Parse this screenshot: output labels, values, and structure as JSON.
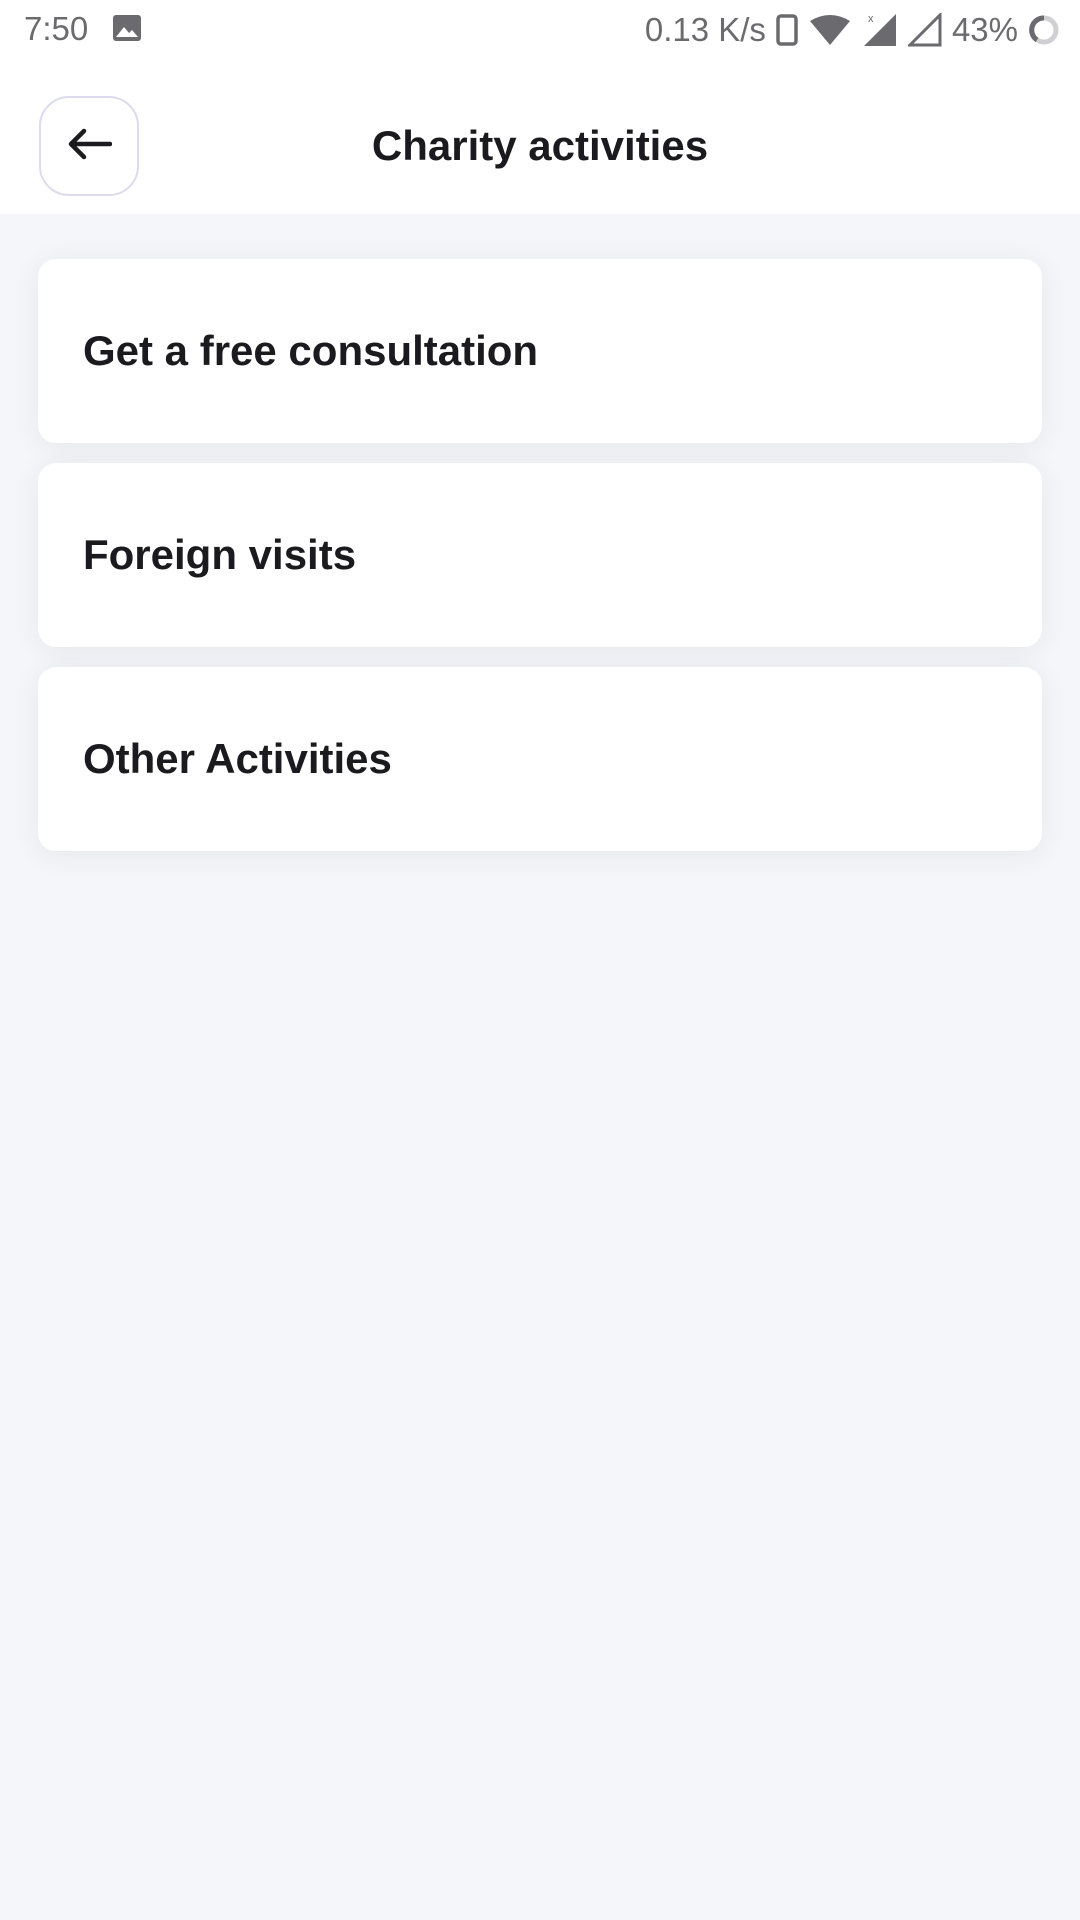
{
  "status_bar": {
    "time": "7:50",
    "net_speed": "0.13 K/s",
    "battery": "43%",
    "icons": [
      "gallery-icon",
      "phone-icon",
      "wifi-icon",
      "signal-icon",
      "signal-empty-icon",
      "battery-ring-icon"
    ]
  },
  "header": {
    "title": "Charity activities",
    "back_icon": "arrow-left-icon"
  },
  "items": [
    {
      "label": "Get a free consultation"
    },
    {
      "label": "Foreign visits"
    },
    {
      "label": "Other Activities"
    }
  ],
  "colors": {
    "background": "#f5f6f9",
    "card": "#ffffff",
    "text": "#1b1b1f",
    "back_border": "#dcdcee"
  }
}
